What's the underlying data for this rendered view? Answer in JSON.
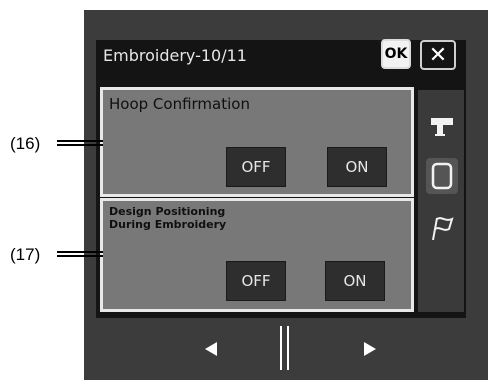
{
  "header": {
    "title": "Embroidery-10/11",
    "ok_label": "OK",
    "close_label": "✕"
  },
  "settings": [
    {
      "callout": "(16)",
      "label": "Hoop Confirmation",
      "off_label": "OFF",
      "on_label": "ON"
    },
    {
      "callout": "(17)",
      "label_line1": "Design Positioning",
      "label_line2": "During Embroidery",
      "off_label": "OFF",
      "on_label": "ON"
    }
  ],
  "side_tabs": [
    {
      "icon": "sewing-machine-icon",
      "selected": false
    },
    {
      "icon": "embroidery-hoop-icon",
      "selected": true
    },
    {
      "icon": "flag-icon",
      "selected": false
    }
  ],
  "bottom_nav": {
    "prev_icon": "previous-page-icon",
    "page_icon": "page-indicator-icon",
    "next_icon": "next-page-icon"
  },
  "colors": {
    "frame": "#3c3c3c",
    "screen": "#141414",
    "panel": "#787878",
    "panel_border": "#e8e8e8",
    "toggle": "#2e2e2e"
  }
}
